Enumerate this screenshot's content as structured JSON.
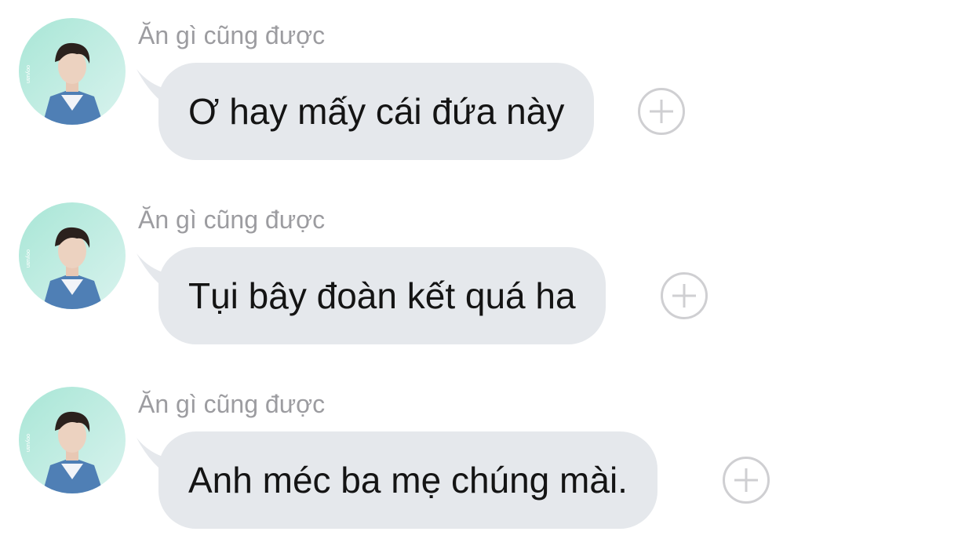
{
  "messages": [
    {
      "sender": "Ăn gì cũng được",
      "text": "Ơ hay mấy cái đứa này"
    },
    {
      "sender": "Ăn gì cũng được",
      "text": "Tụi bây đoàn kết quá ha"
    },
    {
      "sender": "Ăn gì cũng được",
      "text": "Anh méc ba mẹ chúng mài."
    }
  ],
  "colors": {
    "bubble": "#e5e8ec",
    "sender": "#9c9ca0",
    "text": "#141414",
    "add_button": "#cfcfd2",
    "avatar_bg": "#bfece1"
  },
  "icons": {
    "add_reaction": "plus-circle-icon",
    "avatar": "profile-photo"
  }
}
